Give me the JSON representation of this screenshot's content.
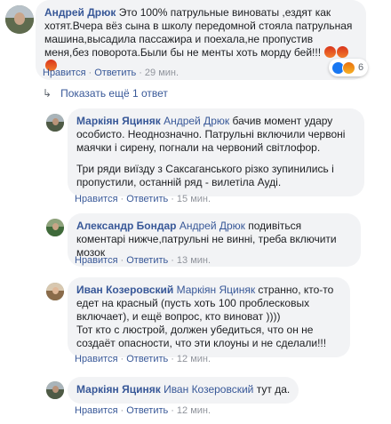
{
  "comments": [
    {
      "author": "Андрей Дрюк",
      "text": "Это 100% патрульные виноваты ,ездят как хотят.Вчера вёз сына в школу передомной стояла патрульная машина,высадила пассажира и поехала,не пропустив меня,без поворота.Были бы не менты хоть морду бей!!!",
      "emojis": [
        "angry-emoji",
        "angry-emoji",
        "angry-emoji"
      ],
      "actions": {
        "like": "Нравится",
        "reply": "Ответить",
        "time": "29 мин."
      },
      "reactions": {
        "icons": [
          "like-reaction-icon",
          "angry-reaction-icon"
        ],
        "count": "6"
      }
    }
  ],
  "show_more": {
    "label": "Показать ещё 1 ответ"
  },
  "replies": [
    {
      "author": "Маркіян Яциняк",
      "mention": "Андрей Дрюк",
      "paragraphs": [
        "бачив момент удару особисто. Неоднозначно. Патрульні включили червоні маячки і сирену, погнали на червоний світлофор.",
        "Три ряди виїзду з Саксаганського різко зупинились і пропустили, останній ряд - вилетіла Ауді."
      ],
      "actions": {
        "like": "Нравится",
        "reply": "Ответить",
        "time": "15 мин."
      }
    },
    {
      "author": "Александр Бондар",
      "mention": "Андрей Дрюк",
      "paragraphs": [
        "подивіться коментарі нижче,патрульні не винні, треба включити мозок"
      ],
      "actions": {
        "like": "Нравится",
        "reply": "Ответить",
        "time": "13 мин."
      }
    },
    {
      "author": "Иван Козеровский",
      "mention": "Маркіян Яциняк",
      "paragraphs": [
        "странно, кто-то едет на красный (пусть хоть 100 проблесковых включает), и ещё вопрос, кто виноват ))))",
        "Тот кто с люстрой, должен убедиться, что он не создаёт опасности, что эти клоуны и не сделали!!!"
      ],
      "actions": {
        "like": "Нравится",
        "reply": "Ответить",
        "time": "12 мин."
      }
    },
    {
      "author": "Маркіян Яциняк",
      "mention": "Иван Козеровский",
      "paragraphs": [
        "тут да."
      ],
      "actions": {
        "like": "Нравится",
        "reply": "Ответить",
        "time": "12 мин."
      }
    }
  ],
  "colors": {
    "link": "#385898",
    "bubble": "#f2f3f5",
    "meta": "#90949c"
  }
}
